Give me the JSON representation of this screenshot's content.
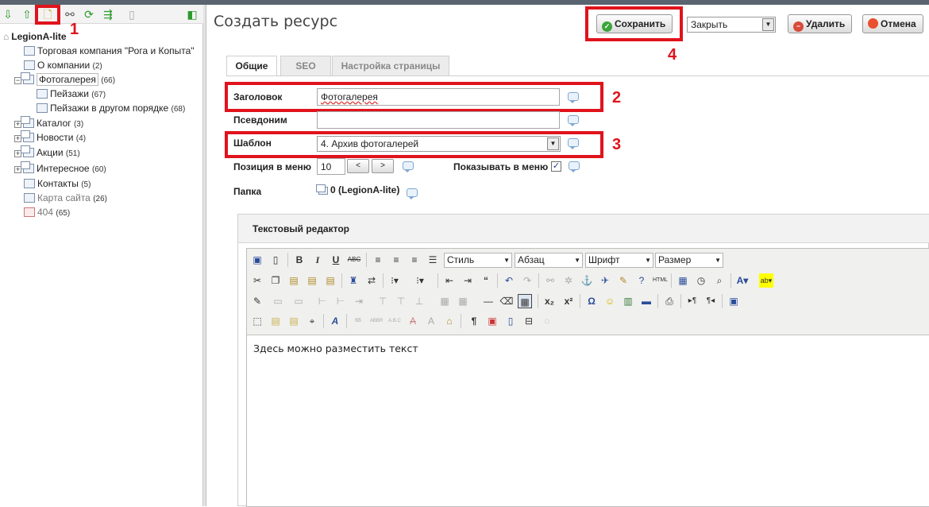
{
  "tree": {
    "root": "LegionA-lite",
    "items": [
      {
        "label": "Торговая компания \"Рога и Копыта\"",
        "count": ""
      },
      {
        "label": "О компании",
        "count": "(2)"
      },
      {
        "label": "Фотогалерея",
        "count": "(66)"
      },
      {
        "label": "Пейзажи",
        "count": "(67)"
      },
      {
        "label": "Пейзажи в другом порядке",
        "count": "(68)"
      },
      {
        "label": "Каталог",
        "count": "(3)"
      },
      {
        "label": "Новости",
        "count": "(4)"
      },
      {
        "label": "Акции",
        "count": "(51)"
      },
      {
        "label": "Интересное",
        "count": "(60)"
      },
      {
        "label": "Контакты",
        "count": "(5)"
      },
      {
        "label": "Карта сайта",
        "count": "(26)"
      },
      {
        "label": "404",
        "count": "(65)"
      }
    ]
  },
  "markers": {
    "m1": "1",
    "m2": "2",
    "m3": "3",
    "m4": "4"
  },
  "header": {
    "title": "Создать ресурс",
    "save": "Сохранить",
    "close_select": "Закрыть",
    "delete": "Удалить",
    "cancel": "Отмена"
  },
  "tabs": [
    "Общие",
    "SEO",
    "Настройка страницы"
  ],
  "form": {
    "title_label": "Заголовок",
    "title_value": "Фотогалерея",
    "alias_label": "Псевдоним",
    "alias_value": "",
    "template_label": "Шаблон",
    "template_value": "4. Архив фотогалерей",
    "menu_pos_label": "Позиция в меню",
    "menu_pos_value": "10",
    "prev": "<",
    "next": ">",
    "show_in_menu_label": "Показывать в меню",
    "folder_label": "Папка",
    "folder_value": "0 (LegionA-lite)"
  },
  "editor": {
    "heading": "Текстовый редактор",
    "style_select": "Стиль",
    "format_select": "Абзац",
    "font_select": "Шрифт",
    "size_select": "Размер",
    "body": "Здесь можно разместить текст"
  }
}
